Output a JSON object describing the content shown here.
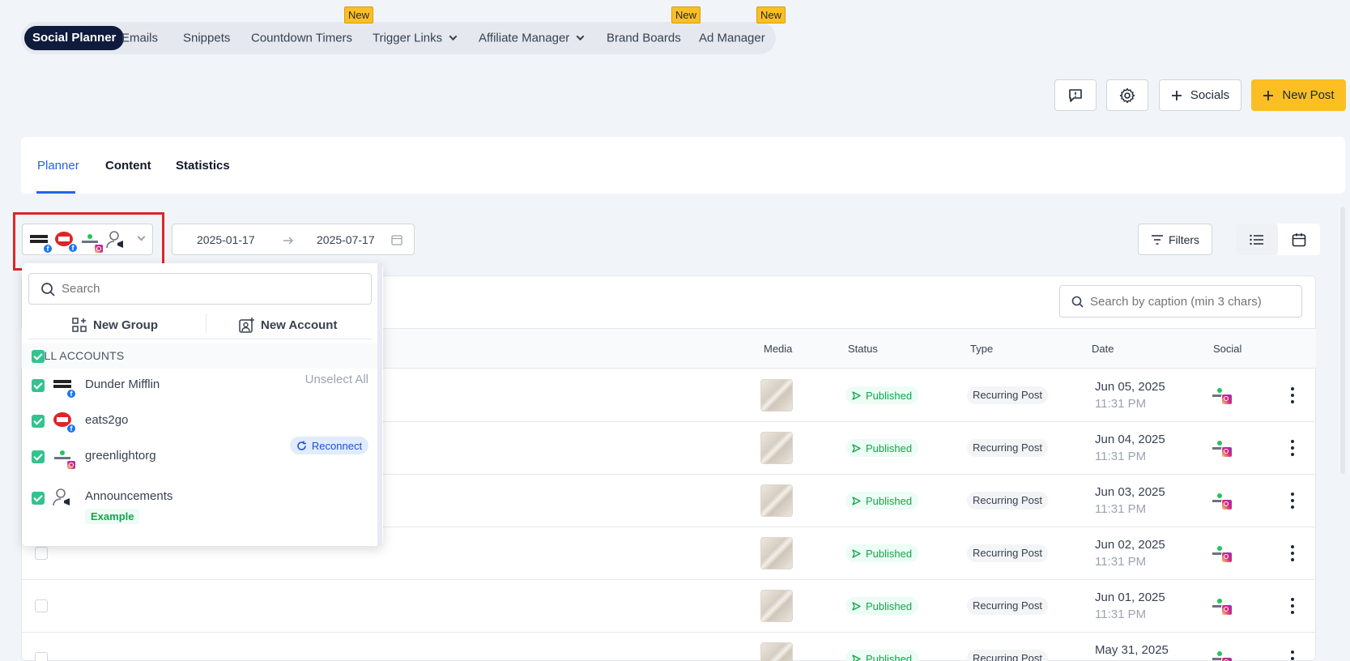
{
  "topnav": {
    "items": [
      {
        "label": "Social Planner",
        "active": true
      },
      {
        "label": "Emails"
      },
      {
        "label": "Snippets"
      },
      {
        "label": "Countdown Timers",
        "badge": "New"
      },
      {
        "label": "Trigger Links",
        "dropdown": true
      },
      {
        "label": "Affiliate Manager",
        "dropdown": true
      },
      {
        "label": "Brand Boards",
        "badge": "New"
      },
      {
        "label": "Ad Manager",
        "badge": "New"
      }
    ]
  },
  "toolbar": {
    "feedback_icon": "message-alert-icon",
    "settings_icon": "gear-icon",
    "socials_label": "Socials",
    "new_post_label": "New Post"
  },
  "tabs": [
    "Planner",
    "Content",
    "Statistics"
  ],
  "date_range": {
    "start": "2025-01-17",
    "end": "2025-07-17"
  },
  "filters_label": "Filters",
  "caption_search_placeholder": "Search by caption (min 3 chars)",
  "table": {
    "headers": {
      "media": "Media",
      "status": "Status",
      "type": "Type",
      "date": "Date",
      "social": "Social"
    },
    "rows": [
      {
        "status": "Published",
        "type": "Recurring Post",
        "date": "Jun 05, 2025",
        "time": "11:31 PM"
      },
      {
        "status": "Published",
        "type": "Recurring Post",
        "date": "Jun 04, 2025",
        "time": "11:31 PM"
      },
      {
        "status": "Published",
        "type": "Recurring Post",
        "date": "Jun 03, 2025",
        "time": "11:31 PM"
      },
      {
        "status": "Published",
        "type": "Recurring Post",
        "date": "Jun 02, 2025",
        "time": "11:31 PM"
      },
      {
        "status": "Published",
        "type": "Recurring Post",
        "date": "Jun 01, 2025",
        "time": "11:31 PM"
      },
      {
        "status": "Published",
        "type": "Recurring Post",
        "date": "May 31, 2025",
        "time": ""
      }
    ]
  },
  "dropdown": {
    "search_placeholder": "Search",
    "new_group_label": "New Group",
    "new_account_label": "New Account",
    "section_label": "ALL ACCOUNTS",
    "unselect_all_label": "Unselect All",
    "accounts": [
      {
        "name": "Dunder Mifflin",
        "platform": "facebook"
      },
      {
        "name": "eats2go",
        "platform": "facebook",
        "action": "Reconnect"
      },
      {
        "name": "greenlightorg",
        "platform": "instagram"
      },
      {
        "name": "Announcements",
        "platform": "community",
        "tag": "Example"
      }
    ]
  },
  "colors": {
    "accent": "#fbbf24",
    "primary": "#2563eb",
    "navy": "#0f1b3d",
    "success": "#16a34a",
    "highlight": "#dc2626"
  }
}
